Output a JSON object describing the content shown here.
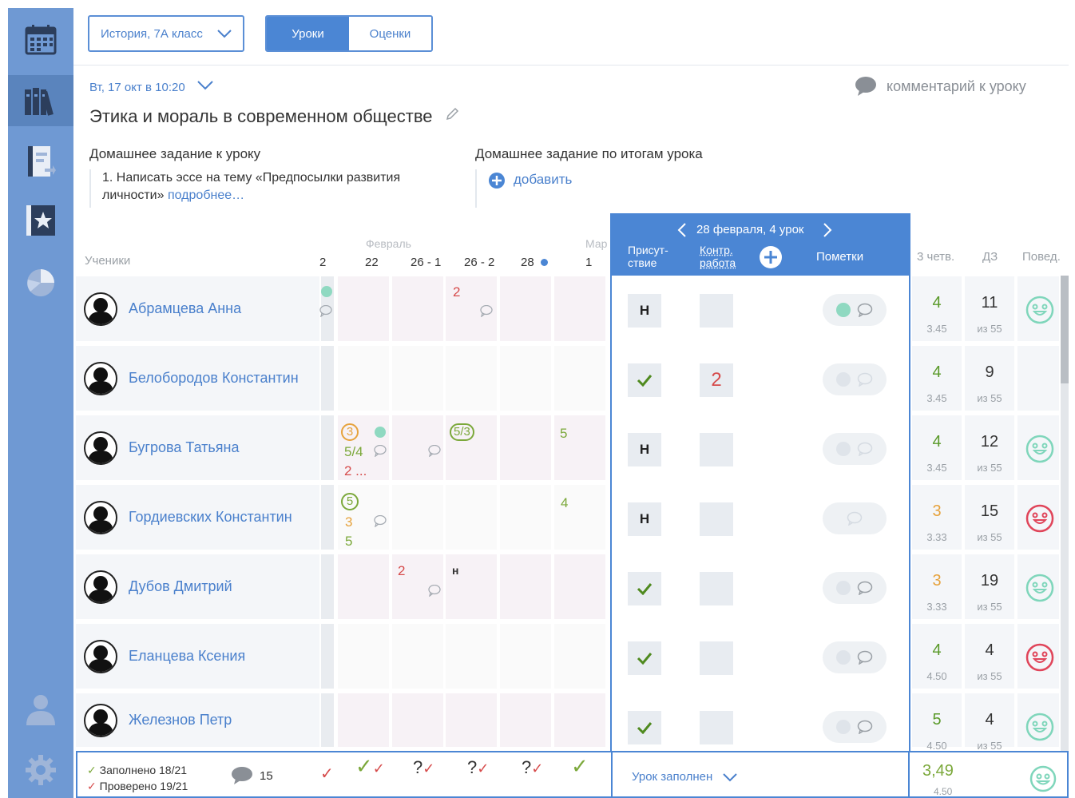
{
  "colors": {
    "accent": "#4b86d4",
    "sidebar": "#6f99d3",
    "grade_red": "#d64b4b",
    "grade_green": "#7ba83a",
    "grade_orange": "#e6a23c"
  },
  "sidebar": {
    "items": [
      "calendar-icon",
      "bookshelf-icon",
      "report-icon",
      "star-icon",
      "pie-chart-icon",
      "person-icon",
      "gear-icon"
    ]
  },
  "topbar": {
    "class_select": "История, 7А класс",
    "tabs": [
      "Уроки",
      "Оценки"
    ]
  },
  "lesson": {
    "date": "Вт, 17 окт в 10:20",
    "title": "Этика и мораль в современном обществе",
    "comment_label": "комментарий к уроку",
    "hw_lesson_title": "Домашнее задание к уроку",
    "hw_lesson_text": "1. Написать эссе на тему «Предпосылки развития личности»",
    "hw_more": "подробнее…",
    "hw_result_title": "Домашнее задание по итогам урока",
    "hw_add": "добавить"
  },
  "table": {
    "students_label": "Ученики",
    "month_feb": "Февраль",
    "month_mar": "Мар",
    "col_labels": [
      "2",
      "22",
      "26 - 1",
      "26 - 2",
      "28",
      "1"
    ],
    "summary_headers": [
      "3 четв.",
      "ДЗ",
      "Повед."
    ]
  },
  "panel": {
    "date_label": "28 февраля, 4 урок",
    "col_attendance": "Присут-ствие",
    "col_control": "Контр. работа",
    "col_notes": "Пометки"
  },
  "students": [
    {
      "name": "Абрамцева Анна",
      "attendance": "Н",
      "control": "",
      "q3": "4",
      "q3_avg": "3.45",
      "hw": "11",
      "hw_of": "из 55",
      "behavior": "happy"
    },
    {
      "name": "Белобородов Константин",
      "attendance": "check",
      "control": "2",
      "q3": "4",
      "q3_avg": "3.45",
      "hw": "9",
      "hw_of": "из 55",
      "behavior": ""
    },
    {
      "name": "Бугрова Татьяна",
      "attendance": "Н",
      "control": "",
      "q3": "4",
      "q3_avg": "3.45",
      "hw": "12",
      "hw_of": "из 55",
      "behavior": "happy"
    },
    {
      "name": "Гордиевских Константин",
      "attendance": "Н",
      "control": "",
      "q3": "3",
      "q3_avg": "3.33",
      "hw": "15",
      "hw_of": "из 55",
      "behavior": "bad"
    },
    {
      "name": "Дубов Дмитрий",
      "attendance": "check",
      "control": "",
      "q3": "3",
      "q3_avg": "3.33",
      "hw": "19",
      "hw_of": "из 55",
      "behavior": "happy"
    },
    {
      "name": "Еланцева Ксения",
      "attendance": "check",
      "control": "",
      "q3": "4",
      "q3_avg": "4.50",
      "hw": "4",
      "hw_of": "из 55",
      "behavior": "bad"
    },
    {
      "name": "Железнов Петр",
      "attendance": "check",
      "control": "",
      "q3": "5",
      "q3_avg": "4.50",
      "hw": "4",
      "hw_of": "из 55",
      "behavior": "happy"
    }
  ],
  "grades": {
    "r0_c3": "2",
    "r1_none": "",
    "r2_c1a": "3",
    "r2_c1b": "5/4",
    "r2_c1c": "2 ...",
    "r2_c3": "5/3",
    "r2_c5": "5",
    "r3_c1a": "5",
    "r3_c1b": "3",
    "r3_c1c": "5",
    "r3_c5": "4",
    "r4_c2": "2",
    "r4_c3": "н"
  },
  "footer": {
    "filled": "Заполнено  18/21",
    "checked": "Проверено 19/21",
    "comments_count": "15",
    "lesson_status": "Урок заполнен",
    "avg": "3,49",
    "avg_sub": "4.50",
    "col_marks": [
      "?",
      "?",
      "?"
    ]
  }
}
